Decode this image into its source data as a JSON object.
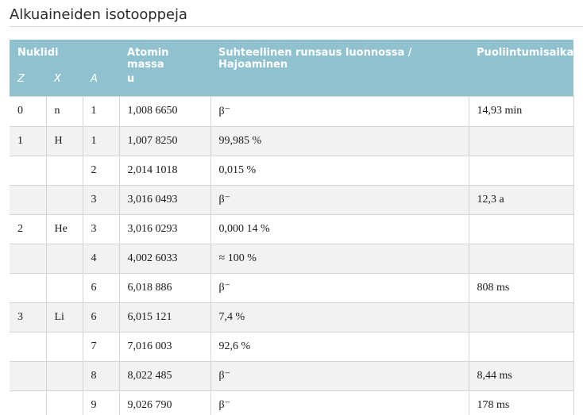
{
  "title": "Alkuaineiden isotooppeja",
  "table": {
    "header": {
      "nuklidi": "Nuklidi",
      "mass": "Atomin massa",
      "mass_unit": "u",
      "abundance": "Suhteellinen runsaus luonnossa / Hajoaminen",
      "halflife": "Puoliintumisaika",
      "z": "Z",
      "x": "X",
      "a": "A"
    },
    "rows": [
      {
        "z": "0",
        "x": "n",
        "a": "1",
        "mass": "1,008 6650",
        "abundance": "β⁻",
        "halflife": "14,93 min"
      },
      {
        "z": "1",
        "x": "H",
        "a": "1",
        "mass": "1,007 8250",
        "abundance": "99,985 %",
        "halflife": ""
      },
      {
        "z": "",
        "x": "",
        "a": "2",
        "mass": "2,014 1018",
        "abundance": "0,015 %",
        "halflife": ""
      },
      {
        "z": "",
        "x": "",
        "a": "3",
        "mass": "3,016 0493",
        "abundance": "β⁻",
        "halflife": "12,3 a"
      },
      {
        "z": "2",
        "x": "He",
        "a": "3",
        "mass": "3,016 0293",
        "abundance": "0,000 14 %",
        "halflife": ""
      },
      {
        "z": "",
        "x": "",
        "a": "4",
        "mass": "4,002 6033",
        "abundance": "≈ 100 %",
        "halflife": ""
      },
      {
        "z": "",
        "x": "",
        "a": "6",
        "mass": "6,018 886",
        "abundance": "β⁻",
        "halflife": "808 ms"
      },
      {
        "z": "3",
        "x": "Li",
        "a": "6",
        "mass": "6,015 121",
        "abundance": "7,4 %",
        "halflife": ""
      },
      {
        "z": "",
        "x": "",
        "a": "7",
        "mass": "7,016 003",
        "abundance": "92,6 %",
        "halflife": ""
      },
      {
        "z": "",
        "x": "",
        "a": "8",
        "mass": "8,022 485",
        "abundance": "β⁻",
        "halflife": "8,44 ms"
      },
      {
        "z": "",
        "x": "",
        "a": "9",
        "mass": "9,026 790",
        "abundance": "β⁻",
        "halflife": "178 ms"
      }
    ]
  }
}
